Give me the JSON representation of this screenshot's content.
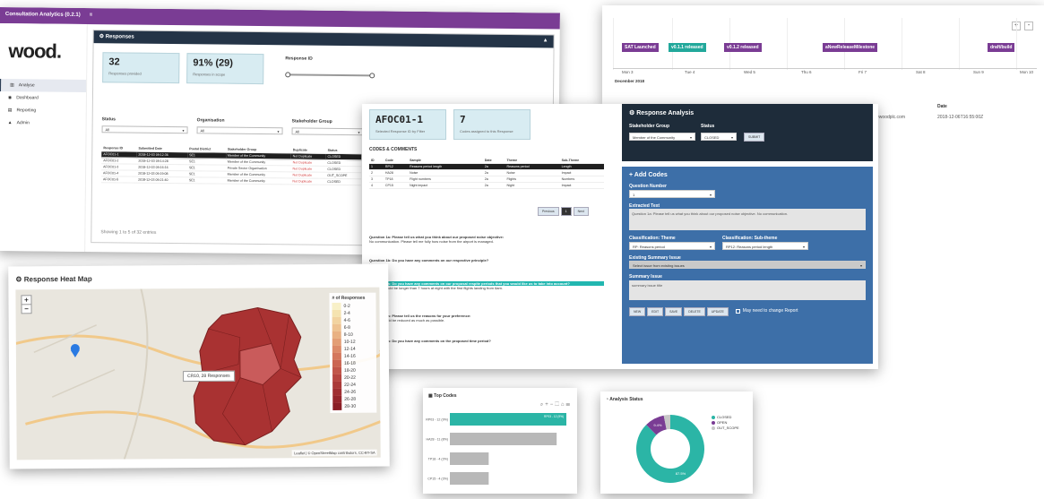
{
  "dashboard": {
    "app_title": "Consultation Analytics (0.2.1)",
    "menu_icon": "menu-icon",
    "logo": "wood.",
    "sidebar": [
      {
        "label": "Analyse",
        "icon": "chart-icon"
      },
      {
        "label": "Dashboard",
        "icon": "dashboard-icon"
      },
      {
        "label": "Reporting",
        "icon": "file-icon"
      },
      {
        "label": "Admin",
        "icon": "lock-icon"
      }
    ],
    "section_title": "Responses",
    "kpis": [
      {
        "value": "32",
        "label": "Responses provided"
      },
      {
        "value": "91% (29)",
        "label": "Responses in scope"
      }
    ],
    "slider_label": "Response ID",
    "filters": [
      {
        "label": "Status",
        "value": "All"
      },
      {
        "label": "Organisation",
        "value": "All"
      },
      {
        "label": "Stakeholder Group",
        "value": "All"
      }
    ],
    "table_headers": [
      "Response ID",
      "Submitted Date",
      "Postal District",
      "Stakeholder Group",
      "Duplicate",
      "Status"
    ],
    "table_rows": [
      [
        "AFOC01-1",
        "2018-12-03 09:12:36",
        "SE1",
        "Member of the Community",
        "Not Duplicate",
        "CLOSED"
      ],
      [
        "AFOC01-2",
        "2018-12-03 09:14:28",
        "SE1",
        "Member of the Community",
        "Not Duplicate",
        "CLOSED"
      ],
      [
        "AFOC01-3",
        "2018-12-03 09:16:16",
        "SE1",
        "Private Sector Organisation",
        "Not Duplicate",
        "CLOSED"
      ],
      [
        "AFOC01-4",
        "2018-12-03 09:19:08",
        "SE1",
        "Member of the Community",
        "Not Duplicate",
        "OUT_SCOPE"
      ],
      [
        "AFOC01-5",
        "2018-12-03 09:21:40",
        "SE1",
        "Member of the Community",
        "Not Duplicate",
        "CLOSED"
      ]
    ],
    "footer": "Showing 1 to 5 of 32 entries"
  },
  "timeline": {
    "zoom_in": "+",
    "zoom_out": "-",
    "events": [
      {
        "label": "SAT Launched",
        "color": "#7a3c94"
      },
      {
        "label": "v0.1.1 released",
        "color": "#22a89b"
      },
      {
        "label": "v0.1.2 released",
        "color": "#7a3c94"
      },
      {
        "label": "aNewReleaseMilestone",
        "color": "#7a3c94"
      },
      {
        "label": "draft/build",
        "color": "#7a3c94"
      }
    ],
    "dates": [
      "Mon 3",
      "Tue 4",
      "Wed 5",
      "Thu 6",
      "Fri 7",
      "Sat 8",
      "Sun 9",
      "Mon 10"
    ],
    "month": "December 2018",
    "user_email": "user@woodplc.com",
    "date_header": "Date",
    "date_value": "2018-12-06T16:55:00Z"
  },
  "code_response": {
    "kpis": [
      {
        "value": "AFOC01-1",
        "label": "Selected Response ID by Filter"
      },
      {
        "value": "7",
        "label": "Codes assigned to this Response"
      }
    ],
    "section": "CODES & COMMENTS",
    "table_headers": [
      "ID",
      "Code",
      "Sample",
      "Date",
      "Theme",
      "Sub-Theme"
    ],
    "table_rows": [
      [
        "1",
        "RP12",
        "Reasons period length",
        "2a",
        "Reasons period",
        "Length"
      ],
      [
        "2",
        "HA28",
        "Noise",
        "2a",
        "Noise",
        "Impact"
      ],
      [
        "3",
        "TP18",
        "Flight numbers",
        "2a",
        "Flights",
        "Numbers"
      ],
      [
        "4",
        "CP15",
        "Night impact",
        "2a",
        "Night",
        "Impact"
      ]
    ],
    "paging": {
      "prev": "Previous",
      "page": "1",
      "next": "Next"
    },
    "questions": [
      {
        "q": "Question 1a: Please tell us what you think about our proposed noise objective:",
        "a": "No communication. Please tell me fully how noise from the airport is managed.",
        "hl": false
      },
      {
        "q": "Question 1b: Do you have any comments on our respective principle?",
        "a": "No.",
        "hl": false
      },
      {
        "q": "Question 2a: Do you have any comments on our proposal respite periods that you would like us to take into account?",
        "a": "Respite should be longer than 7 hours at night with the first flights landing from 6am.",
        "hl": true
      },
      {
        "q": "Question 3a: Please tell us the reasons for your preference:",
        "a": "Flights should be reduced as much as possible.",
        "hl": false
      },
      {
        "q": "Question 4a: Do you have any comments on the proposed time period?",
        "a": "Too long.",
        "hl": false
      }
    ],
    "analysis_title": "Response Analysis",
    "analysis_fields": [
      {
        "label": "Stakeholder Group",
        "value": "Member of the Community"
      },
      {
        "label": "Status",
        "value": "CLOSED"
      }
    ],
    "submit": "SUBMIT",
    "add_codes_title": "Add Codes",
    "question_number_label": "Question Number",
    "question_number": "1",
    "extracted_text_label": "Extracted Text",
    "extracted_text": "Question 1a: Please tell us what you think about our proposed noise objective. No communication.",
    "theme_label": "Classification: Theme",
    "theme_value": "RP: Reasons period",
    "subtheme_label": "Classification: Sub-theme",
    "subtheme_value": "RP12: Reasons period length",
    "existing_summary_label": "Existing Summary Issue",
    "existing_summary": "Select issue from existing issues",
    "summary_label": "Summary Issue",
    "summary_value": "summary issue title",
    "buttons": [
      "NEW",
      "EDIT",
      "SAVE",
      "DELETE",
      "UPDATE"
    ],
    "checkbox_label": "May need to change Report"
  },
  "heatmap": {
    "title": "Response Heat Map",
    "legend_title": "# of Responses",
    "legend": [
      "0-2",
      "2-4",
      "4-6",
      "6-8",
      "8-10",
      "10-12",
      "12-14",
      "14-16",
      "16-18",
      "18-20",
      "20-22",
      "22-24",
      "24-26",
      "26-28",
      "28-30"
    ],
    "legend_colors": [
      "#f8f0c8",
      "#f5e3b0",
      "#f2d3a0",
      "#eec291",
      "#e9b183",
      "#e39e76",
      "#dc8b6a",
      "#d4785e",
      "#cb6653",
      "#c1564a",
      "#b64641",
      "#ab3a39",
      "#a02f32",
      "#95262c",
      "#8a1e26"
    ],
    "tooltip": "CR10, 28 Responses",
    "attribution": "Leaflet | © OpenStreetMap contributors, CC-BY-SA",
    "zoom_in": "+",
    "zoom_out": "−"
  },
  "top_codes": {
    "title": "Top Codes",
    "bars": [
      {
        "label": "RP03 - 12 (9%)",
        "value": 12,
        "color": "#2bb5a6",
        "tag": "RP03 - 12 (9%)"
      },
      {
        "label": "HA28 - 11 (8%)",
        "value": 11,
        "color": "#b8b8b8",
        "tag": ""
      },
      {
        "label": "TP18 - 4 (3%)",
        "value": 4,
        "color": "#b8b8b8",
        "tag": ""
      },
      {
        "label": "CP15 - 4 (3%)",
        "value": 4,
        "color": "#b8b8b8",
        "tag": ""
      }
    ]
  },
  "analysis_status": {
    "title": "Analysis Status",
    "legend": [
      {
        "label": "CLOSED",
        "color": "#2bb5a6"
      },
      {
        "label": "OPEN",
        "color": "#7a3c94"
      },
      {
        "label": "OUT_SCOPE",
        "color": "#c7c7c7"
      }
    ],
    "chart_data": {
      "type": "pie",
      "labels": [
        "CLOSED",
        "OPEN",
        "OUT_SCOPE"
      ],
      "values": [
        87.5,
        9.4,
        3.1
      ],
      "slice_labels": [
        "87.5%",
        "9.4%",
        ""
      ]
    }
  }
}
